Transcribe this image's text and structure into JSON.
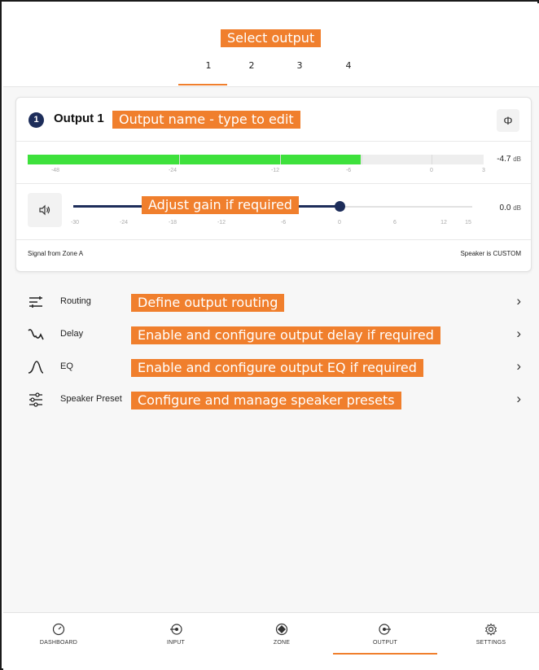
{
  "annotations": {
    "select_output": "Select output",
    "output_name": "Output name - type to edit",
    "adjust_gain": "Adjust gain if required",
    "routing": "Define output routing",
    "delay": "Enable and configure output delay if required",
    "eq": "Enable and configure output EQ if required",
    "speaker_preset": "Configure and manage speaker presets"
  },
  "tabs": [
    {
      "label": "1",
      "active": true
    },
    {
      "label": "2",
      "active": false
    },
    {
      "label": "3",
      "active": false
    },
    {
      "label": "4",
      "active": false
    }
  ],
  "output_card": {
    "number": "1",
    "title": "Output 1",
    "phase_icon": "Φ",
    "meter": {
      "level_fraction": 0.73,
      "value": "-4.7",
      "unit": "dB",
      "ticks": [
        "-48",
        "-24",
        "-12",
        "-6",
        "0",
        "3"
      ]
    },
    "gain": {
      "value": "0.0",
      "unit": "dB",
      "position_fraction": 0.67,
      "ticks": [
        "-30",
        "-24",
        "-18",
        "-12",
        "-6",
        "0",
        "6",
        "12",
        "15"
      ]
    },
    "signal_text": "Signal from Zone A",
    "speaker_text": "Speaker is CUSTOM"
  },
  "menu": [
    {
      "icon": "routing-icon",
      "label": "Routing"
    },
    {
      "icon": "delay-icon",
      "label": "Delay"
    },
    {
      "icon": "eq-icon",
      "label": "EQ"
    },
    {
      "icon": "speaker-preset-icon",
      "label": "Speaker Preset"
    }
  ],
  "bottom_nav": [
    {
      "icon": "dashboard-icon",
      "label": "DASHBOARD"
    },
    {
      "icon": "input-icon",
      "label": "INPUT"
    },
    {
      "icon": "zone-icon",
      "label": "ZONE"
    },
    {
      "icon": "output-icon",
      "label": "OUTPUT",
      "active": true
    },
    {
      "icon": "settings-icon",
      "label": "SETTINGS"
    }
  ],
  "colors": {
    "accent": "#f07f2d",
    "navy": "#1d2d5a",
    "meter_green": "#3ee13c"
  }
}
